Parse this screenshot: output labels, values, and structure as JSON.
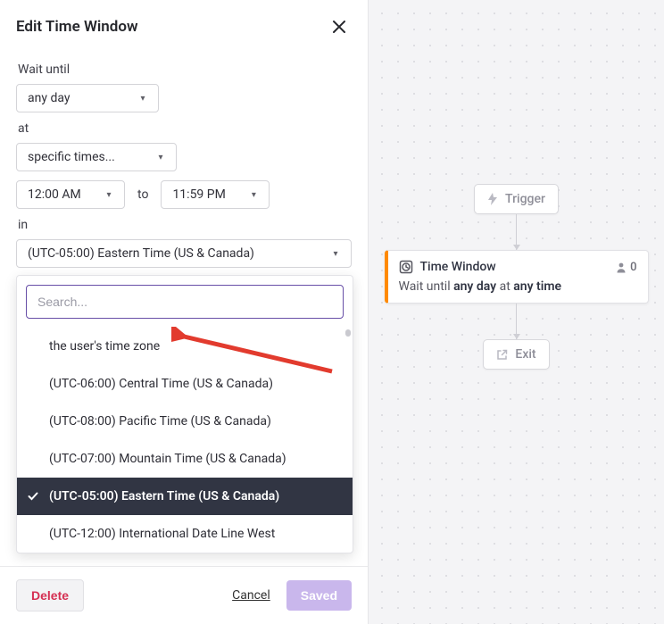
{
  "panel": {
    "title": "Edit Time Window",
    "labels": {
      "wait_until": "Wait until",
      "at": "at",
      "in": "in",
      "to": "to"
    },
    "selects": {
      "day": "any day",
      "time_mode": "specific times...",
      "time_from": "12:00 AM",
      "time_to": "11:59 PM",
      "timezone": "(UTC-05:00) Eastern Time (US & Canada)"
    }
  },
  "dropdown": {
    "placeholder": "Search...",
    "items": [
      {
        "label": "the user's time zone",
        "selected": false
      },
      {
        "label": "(UTC-06:00) Central Time (US & Canada)",
        "selected": false
      },
      {
        "label": "(UTC-08:00) Pacific Time (US & Canada)",
        "selected": false
      },
      {
        "label": "(UTC-07:00) Mountain Time (US & Canada)",
        "selected": false
      },
      {
        "label": "(UTC-05:00) Eastern Time (US & Canada)",
        "selected": true
      },
      {
        "label": "(UTC-12:00) International Date Line West",
        "selected": false
      }
    ]
  },
  "footer": {
    "delete": "Delete",
    "cancel": "Cancel",
    "saved": "Saved"
  },
  "canvas": {
    "trigger": "Trigger",
    "card": {
      "title": "Time Window",
      "body_prefix": "Wait until ",
      "body_bold1": "any day",
      "body_mid": " at ",
      "body_bold2": "any time",
      "count": "0"
    },
    "exit": "Exit"
  }
}
